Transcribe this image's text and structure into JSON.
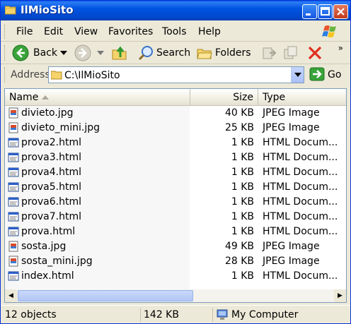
{
  "window": {
    "title": "IlMioSito"
  },
  "menu": {
    "items": [
      {
        "label": "File"
      },
      {
        "label": "Edit"
      },
      {
        "label": "View"
      },
      {
        "label": "Favorites"
      },
      {
        "label": "Tools"
      },
      {
        "label": "Help"
      }
    ]
  },
  "toolbar": {
    "back_label": "Back",
    "search_label": "Search",
    "folders_label": "Folders"
  },
  "address": {
    "label": "Address",
    "value": "C:\\IlMioSito",
    "go_label": "Go"
  },
  "columns": {
    "name": "Name",
    "size": "Size",
    "type": "Type"
  },
  "files": [
    {
      "name": "divieto.jpg",
      "size": "40 KB",
      "type": "JPEG Image",
      "icon": "jpeg-file-icon"
    },
    {
      "name": "divieto_mini.jpg",
      "size": "25 KB",
      "type": "JPEG Image",
      "icon": "jpeg-file-icon"
    },
    {
      "name": "prova2.html",
      "size": "1 KB",
      "type": "HTML Docum...",
      "icon": "html-file-icon"
    },
    {
      "name": "prova3.html",
      "size": "1 KB",
      "type": "HTML Docum...",
      "icon": "html-file-icon"
    },
    {
      "name": "prova4.html",
      "size": "1 KB",
      "type": "HTML Docum...",
      "icon": "html-file-icon"
    },
    {
      "name": "prova5.html",
      "size": "1 KB",
      "type": "HTML Docum...",
      "icon": "html-file-icon"
    },
    {
      "name": "prova6.html",
      "size": "1 KB",
      "type": "HTML Docum...",
      "icon": "html-file-icon"
    },
    {
      "name": "prova7.html",
      "size": "1 KB",
      "type": "HTML Docum...",
      "icon": "html-file-icon"
    },
    {
      "name": "prova.html",
      "size": "1 KB",
      "type": "HTML Docum...",
      "icon": "html-file-icon"
    },
    {
      "name": "sosta.jpg",
      "size": "49 KB",
      "type": "JPEG Image",
      "icon": "jpeg-file-icon"
    },
    {
      "name": "sosta_mini.jpg",
      "size": "28 KB",
      "type": "JPEG Image",
      "icon": "jpeg-file-icon"
    },
    {
      "name": "index.html",
      "size": "1 KB",
      "type": "HTML Docum...",
      "icon": "html-file-icon"
    }
  ],
  "status": {
    "objects": "12 objects",
    "size": "142 KB",
    "location": "My Computer"
  },
  "colors": {
    "titlebar": "#0053e1",
    "window_bg": "#ece9d8",
    "border": "#7f9db9"
  }
}
